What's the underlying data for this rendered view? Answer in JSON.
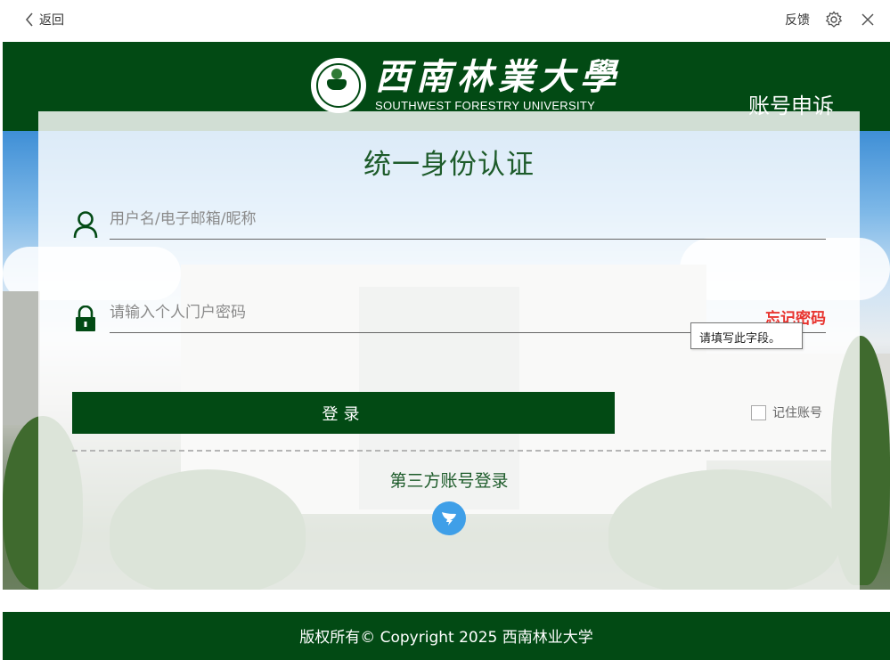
{
  "topbar": {
    "back_label": "返回",
    "feedback_label": "反馈",
    "settings_icon": "gear-icon",
    "close_icon": "close-icon"
  },
  "header": {
    "logo_cn": "西南林業大學",
    "logo_en": "SOUTHWEST FORESTRY UNIVERSITY",
    "appeal_link": "账号申诉"
  },
  "login": {
    "title": "统一身份认证",
    "username_placeholder": "用户名/电子邮箱/昵称",
    "password_placeholder": "请输入个人门户密码",
    "forgot_password": "忘记密码",
    "tooltip": "请填写此字段。",
    "submit_label": "登录",
    "remember_label": "记住账号",
    "third_party_label": "第三方账号登录"
  },
  "footer": {
    "copyright": "版权所有© Copyright 2025  西南林业大学"
  },
  "colors": {
    "brand_green": "#024a14",
    "title_green": "#1d5b2a",
    "forgot_red": "#e8342f",
    "dingtalk_blue": "#3f9fe8"
  }
}
